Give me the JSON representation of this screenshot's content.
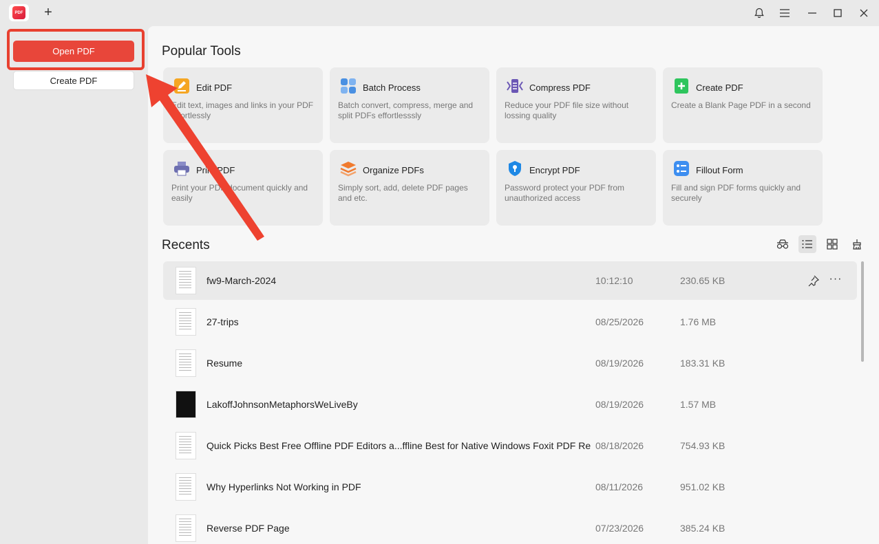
{
  "titlebar": {
    "logo_text": "PDF",
    "new_tab": "+",
    "icons": [
      "bell-icon",
      "menu-icon",
      "minimize-icon",
      "maximize-icon",
      "close-icon"
    ]
  },
  "sidebar": {
    "open_pdf": "Open PDF",
    "create_pdf": "Create PDF"
  },
  "main": {
    "popular_tools_title": "Popular Tools",
    "tools": [
      {
        "name": "Edit PDF",
        "desc": "Edit text, images and links in your PDF effortlessly",
        "icon": "edit-icon",
        "color": "#f5a623"
      },
      {
        "name": "Batch Process",
        "desc": "Batch convert, compress, merge and split PDFs effortlesssly",
        "icon": "batch-icon",
        "color": "#4a90e2"
      },
      {
        "name": "Compress PDF",
        "desc": "Reduce your PDF file size without lossing quality",
        "icon": "compress-icon",
        "color": "#6b57b5"
      },
      {
        "name": "Create PDF",
        "desc": "Create a Blank Page PDF in a second",
        "icon": "create-icon",
        "color": "#2ec55d"
      },
      {
        "name": "Print PDF",
        "desc": "Print your PDF document quickly and easily",
        "icon": "print-icon",
        "color": "#6d6fb0"
      },
      {
        "name": "Organize PDFs",
        "desc": "Simply sort, add, delete PDF pages and etc.",
        "icon": "organize-icon",
        "color": "#f07a2e"
      },
      {
        "name": "Encrypt PDF",
        "desc": "Password protect your PDF from unauthorized access",
        "icon": "encrypt-icon",
        "color": "#1e88e5"
      },
      {
        "name": "Fillout Form",
        "desc": "Fill and sign PDF forms quickly and securely",
        "icon": "form-icon",
        "color": "#3d8ef0"
      }
    ],
    "recents_title": "Recents",
    "view_icons": [
      "filter-icon",
      "list-view-icon",
      "grid-view-icon",
      "clean-icon"
    ],
    "recents": [
      {
        "name": "fw9-March-2024",
        "date": "10:12:10",
        "size": "230.65 KB"
      },
      {
        "name": "27-trips",
        "date": "08/25/2026",
        "size": "1.76 MB"
      },
      {
        "name": "Resume",
        "date": "08/19/2026",
        "size": "183.31 KB"
      },
      {
        "name": "LakoffJohnsonMetaphorsWeLiveBy",
        "date": "08/19/2026",
        "size": "1.57 MB"
      },
      {
        "name": "Quick Picks Best Free Offline PDF Editors a...ffline Best for Native Windows Foxit PDF Re",
        "date": "08/18/2026",
        "size": "754.93 KB"
      },
      {
        "name": "Why Hyperlinks Not Working in PDF",
        "date": "08/11/2026",
        "size": "951.02 KB"
      },
      {
        "name": "Reverse PDF Page",
        "date": "07/23/2026",
        "size": "385.24 KB"
      }
    ],
    "more_label": "···"
  },
  "colors": {
    "accent": "#e8463a",
    "annotation": "#e8402f"
  }
}
